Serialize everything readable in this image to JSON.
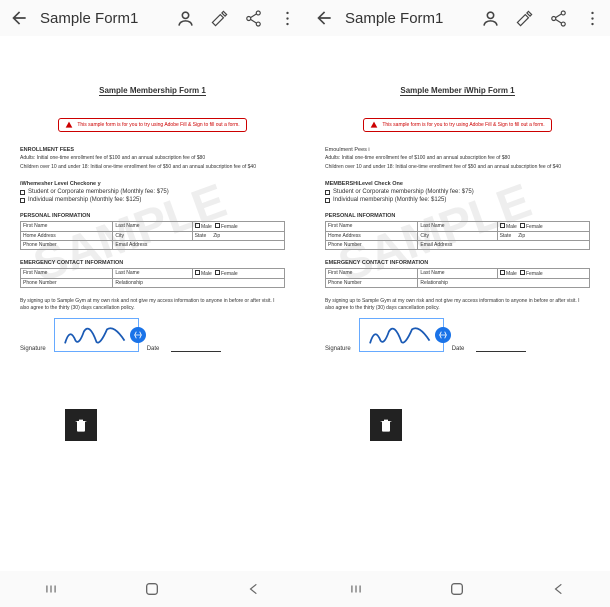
{
  "topbar": {
    "title": "Sample Form1"
  },
  "doc": {
    "title_left": "Sample Membership Form 1",
    "title_right": "Sample Member iWhip Form 1",
    "annotation": "This sample form is for you to try using Adobe Fill & Sign to fill out a form.",
    "enrollment": {
      "label_left": "ENROLLMENT FEES",
      "label_right": "Emoulment Pees i",
      "line1": "Adults: Initial one-time enrollment fee of $100 and an annual subscription fee of $80",
      "line2": "Children over 10 and under 18: Initial one-time enrollment fee of $50 and an annual subscription fee of $40"
    },
    "membership": {
      "label_left": "iWhemesher Levei Checkone y",
      "label_right": "MEMBERSHiLevel Check One",
      "opt1": "Student or Corporate membership (Monthly fee: $75)",
      "opt2": "Individual membership (Monthly fee: $125)"
    },
    "personal": {
      "label": "PERSONAL INFORMATION",
      "first_name": "First Name",
      "last_name": "Last Name",
      "male": "Male",
      "female": "Female",
      "home_address": "Home Address",
      "city": "City",
      "state": "State",
      "zip": "Zip",
      "phone": "Phone Number",
      "email": "Email Address"
    },
    "emergency": {
      "label": "EMERGENCY CONTACT INFORMATION",
      "first_name": "First Name",
      "last_name": "Last Name",
      "male": "Male",
      "female": "Female",
      "phone": "Phone Number",
      "relationship": "Relationship"
    },
    "consent": "By signing up to Sample Gym at my own risk and not give my access information to anyone in before or after visit. I also agree to the thirty (30) days cancellation policy.",
    "signature_label": "Signature",
    "date_label": "Date"
  },
  "watermark": "SAMPLE"
}
